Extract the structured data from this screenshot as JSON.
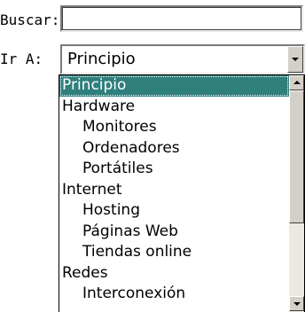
{
  "search": {
    "label": "Buscar:",
    "value": ""
  },
  "goto": {
    "label": "Ir A:",
    "selected": "Principio"
  },
  "options": [
    {
      "label": "Principio",
      "level": 0,
      "selected": true
    },
    {
      "label": "Hardware",
      "level": 0
    },
    {
      "label": "Monitores",
      "level": 1
    },
    {
      "label": "Ordenadores",
      "level": 1
    },
    {
      "label": "Portátiles",
      "level": 1
    },
    {
      "label": "Internet",
      "level": 0
    },
    {
      "label": "Hosting",
      "level": 1
    },
    {
      "label": "Páginas Web",
      "level": 1
    },
    {
      "label": "Tiendas online",
      "level": 1
    },
    {
      "label": "Redes",
      "level": 0
    },
    {
      "label": "Interconexión",
      "level": 1
    }
  ],
  "colors": {
    "selection": "#2f7f7d",
    "chrome": "#d4d0c8"
  }
}
